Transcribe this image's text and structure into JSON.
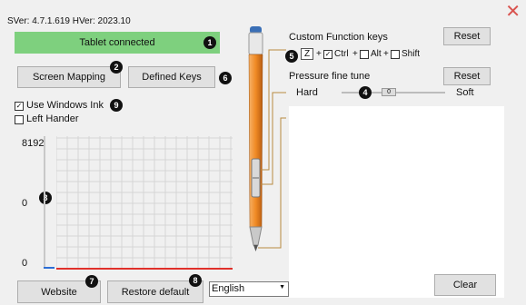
{
  "header": {
    "version_text": "SVer: 4.7.1.619  HVer: 2023.10"
  },
  "status": {
    "text": "Tablet connected"
  },
  "buttons": {
    "screen_mapping": "Screen Mapping",
    "defined_keys": "Defined Keys",
    "website": "Website",
    "restore_default": "Restore default",
    "reset_custom": "Reset",
    "reset_pressure": "Reset",
    "clear": "Clear"
  },
  "options": {
    "use_windows_ink": {
      "label": "Use Windows Ink",
      "checked": true
    },
    "left_hander": {
      "label": "Left Hander",
      "checked": false
    }
  },
  "pressure_chart": {
    "max_label": "8192",
    "mid_label": "0",
    "min_label": "0",
    "current_pressure": 0
  },
  "custom_keys": {
    "title": "Custom Function keys",
    "key_value": "Z",
    "plus": "+",
    "modifiers": [
      {
        "label": "Ctrl",
        "checked": true
      },
      {
        "label": "Alt",
        "checked": false
      },
      {
        "label": "Shift",
        "checked": false
      }
    ]
  },
  "pressure_tune": {
    "title": "Pressure fine tune",
    "hard_label": "Hard",
    "soft_label": "Soft",
    "slider_value_label": "0",
    "slider_fraction": 0.45
  },
  "language": {
    "selected": "English"
  },
  "badges": [
    "1",
    "2",
    "3",
    "4",
    "5",
    "6",
    "7",
    "8",
    "9"
  ],
  "colors": {
    "status_bg": "#7ed07e",
    "pen_orange": "#f08a24",
    "baseline_red": "#e0302a",
    "close_red": "#d9534f"
  }
}
